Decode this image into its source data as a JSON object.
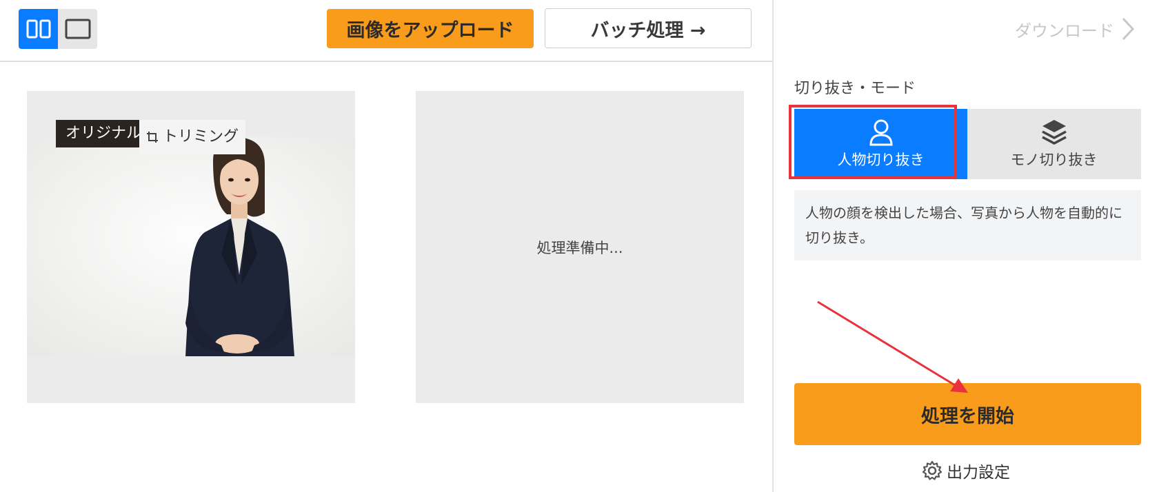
{
  "toolbar": {
    "upload_label": "画像をアップロード",
    "batch_label": "バッチ処理 →"
  },
  "preview": {
    "original_tag": "オリジナル",
    "trim_tag": "トリミング",
    "status": "処理準備中..."
  },
  "sidebar": {
    "download_label": "ダウンロード",
    "mode_title": "切り抜き・モード",
    "modes": [
      {
        "label": "人物切り抜き",
        "icon": "person-icon",
        "selected": true
      },
      {
        "label": "モノ切り抜き",
        "icon": "layers-icon",
        "selected": false
      }
    ],
    "description": "人物の顔を検出した場合、写真から人物を自動的に切り抜き。",
    "start_label": "処理を開始",
    "output_settings_label": "出力設定"
  },
  "colors": {
    "accent_blue": "#0a7cff",
    "accent_orange": "#f99c1c",
    "annotation_red": "#e8323c"
  }
}
